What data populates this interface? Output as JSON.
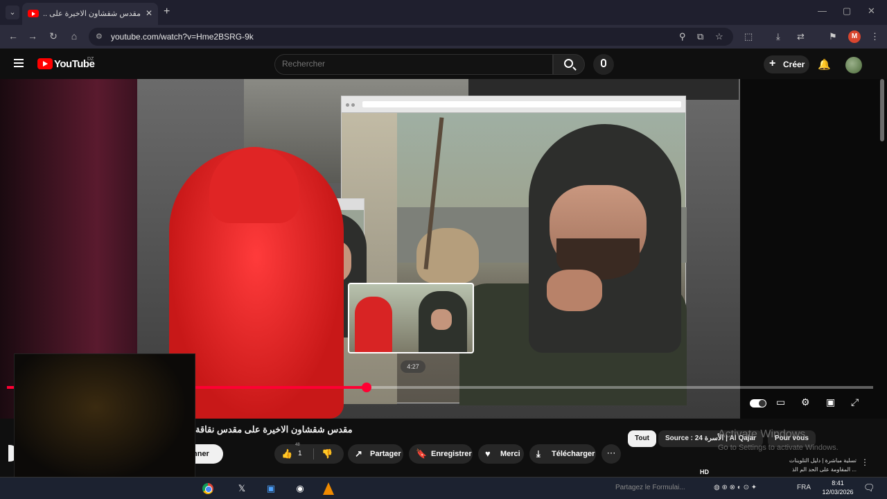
{
  "browser": {
    "tab_title": "مقدس شقشاون الاخيرة على ..",
    "tab_close": "✕",
    "new_tab": "+",
    "url": "youtube.com/watch?v=Hme2BSRG-9k",
    "window_controls": [
      "—",
      "▢",
      "✕"
    ],
    "profile_initial": "M"
  },
  "youtube": {
    "logo_text": "YouTube",
    "country_code": "DZ",
    "search_placeholder": "Rechercher",
    "create_label": "Créer",
    "create_plus": "+"
  },
  "player": {
    "hover_time": "4:27",
    "progress_fraction": 0.415,
    "hover_fraction": 0.47
  },
  "video": {
    "title": "مقدس شقشاون الاخيرة على مقدس نقاقة",
    "subscribe_label": "nner",
    "likes": "1",
    "likes_small": "48",
    "actions": [
      {
        "icon": "↗",
        "label": "Partager"
      },
      {
        "icon": "🔖",
        "label": "Enregistrer"
      },
      {
        "icon": "♥",
        "label": "Merci"
      },
      {
        "icon": "⤓",
        "label": "Télécharger"
      }
    ],
    "more": "⋯"
  },
  "sidebar": {
    "chips": [
      "Tout",
      "Source : 24 الأسرة | Al Qajar",
      "Pour vous"
    ],
    "related": [
      "تسلية مباشرة | دليل التلوينات",
      "... المقاومة على الحد الم الذ"
    ],
    "hd_badge": "HD"
  },
  "watermark": {
    "line1": "Activate Windows",
    "line2": "Go to Settings to activate Windows."
  },
  "taskbar": {
    "search_hint": "Partagez le Formulai...",
    "lang": "FRA",
    "time": "8:41",
    "date": "12/03/2026"
  }
}
